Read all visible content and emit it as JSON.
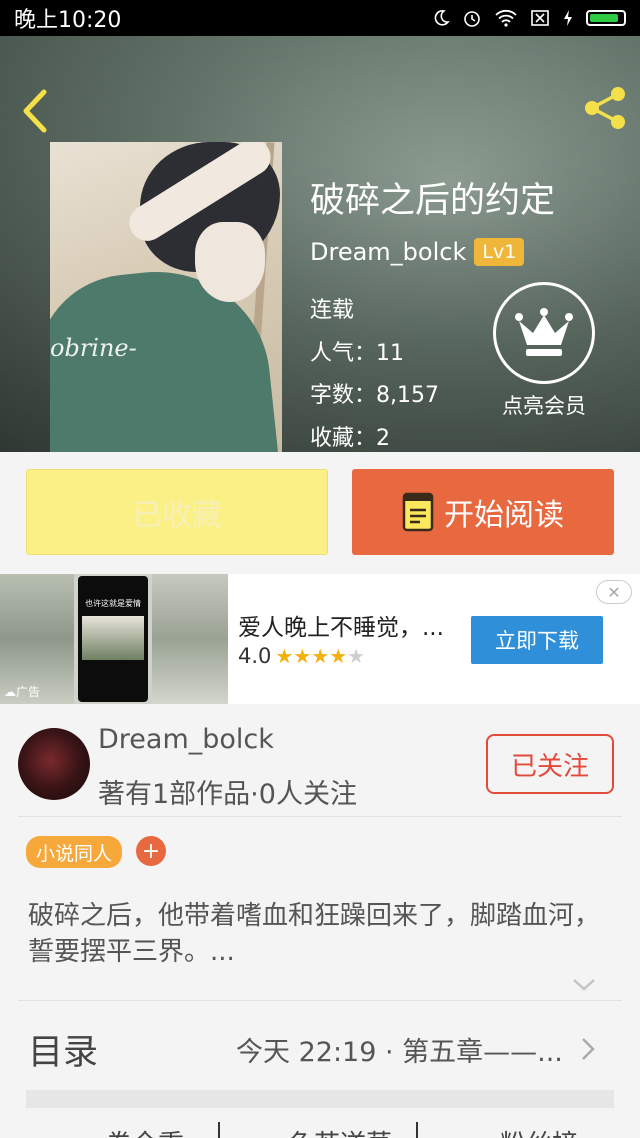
{
  "status_bar": {
    "time": "晚上10:20"
  },
  "book": {
    "title": "破碎之后的约定",
    "author": "Dream_bolck",
    "level": "Lv1",
    "status": "连载",
    "popularity": "人气：11",
    "word_count": "字数：8,157",
    "favorites": "收藏：2",
    "cover_signature": "obrine-"
  },
  "vip": {
    "label": "点亮会员"
  },
  "actions": {
    "collected_label": "已收藏",
    "read_label": "开始阅读"
  },
  "ad": {
    "title": "爱人晚上不睡觉，...",
    "rating": "4.0",
    "rating_value": 4,
    "rating_max": 5,
    "download_label": "立即下载",
    "tag": "☁广告",
    "phone_caption": "也许这就是爱情"
  },
  "author_panel": {
    "name": "Dream_bolck",
    "subtitle": "著有1部作品·0人关注",
    "follow_label": "已关注",
    "tag": "小说同人",
    "tag_add": "+",
    "description": "破碎之后，他带着嗜血和狂躁回来了，脚踏血河，誓要摆平三界。..."
  },
  "toc": {
    "label": "目录",
    "latest": "今天 22:19 · 第五章——..."
  },
  "bottom_tabs": [
    "卷全重",
    "色若逆莫",
    "粉丝榜"
  ],
  "colors": {
    "accent_orange": "#e8683f",
    "collect_yellow": "#fbf085",
    "follow_red": "#e44a3c",
    "ad_blue": "#2f8fd8",
    "tag_orange": "#f6a83b"
  },
  "icons": {
    "back": "chevron-left-icon",
    "share": "share-icon",
    "crown": "crown-icon",
    "book": "book-icon",
    "close": "close-icon",
    "expand": "chevron-down-icon",
    "toc_arrow": "chevron-right-icon"
  }
}
